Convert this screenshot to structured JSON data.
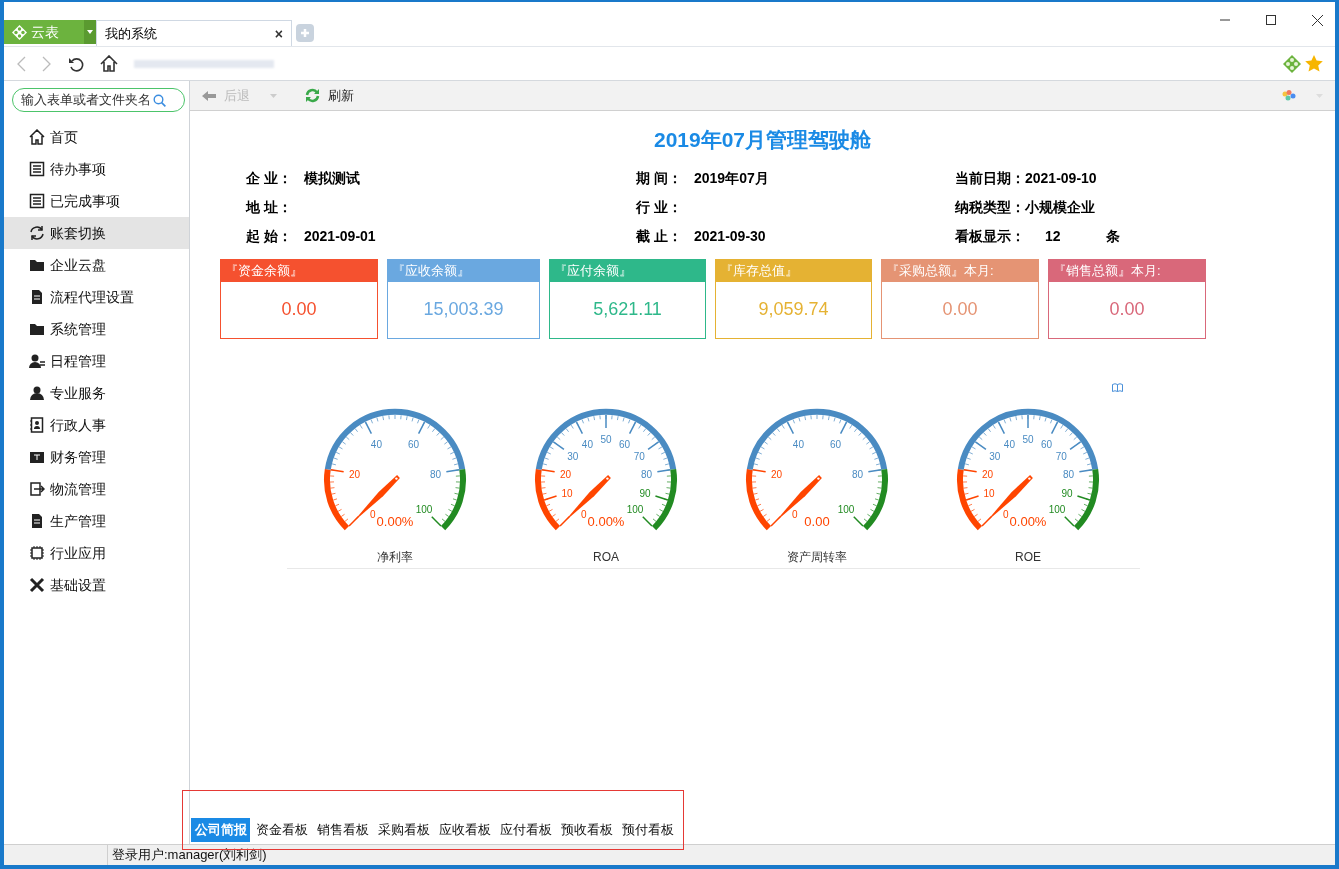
{
  "browser": {
    "brand_button": "云表",
    "tab": {
      "title": "我的系统",
      "close": "×"
    }
  },
  "sidebar": {
    "search": {
      "placeholder": "输入表单或者文件夹名"
    },
    "items": [
      {
        "label": "首页",
        "selected": false
      },
      {
        "label": "待办事项",
        "selected": false
      },
      {
        "label": "已完成事项",
        "selected": false
      },
      {
        "label": "账套切换",
        "selected": true
      },
      {
        "label": "企业云盘",
        "selected": false
      },
      {
        "label": "流程代理设置",
        "selected": false
      },
      {
        "label": "系统管理",
        "selected": false
      },
      {
        "label": "日程管理",
        "selected": false
      },
      {
        "label": "专业服务",
        "selected": false
      },
      {
        "label": "行政人事",
        "selected": false
      },
      {
        "label": "财务管理",
        "selected": false
      },
      {
        "label": "物流管理",
        "selected": false
      },
      {
        "label": "生产管理",
        "selected": false
      },
      {
        "label": "行业应用",
        "selected": false
      },
      {
        "label": "基础设置",
        "selected": false
      }
    ]
  },
  "toolbar": {
    "back": {
      "label": "后退",
      "disabled": true
    },
    "refresh": "刷新"
  },
  "title": "2019年07月管理驾驶舱",
  "info": [
    {
      "label": "企 业：",
      "value": "模拟测试"
    },
    {
      "label": "期 间：",
      "value": "2019年07月"
    },
    {
      "label": "当前日期：",
      "value": "2021-09-10"
    },
    {
      "label": "地 址："
    },
    {
      "label": "行 业："
    },
    {
      "label": "纳税类型：",
      "value": "小规模企业"
    },
    {
      "label": "起 始：",
      "value": "2021-09-01"
    },
    {
      "label": "截 止：",
      "value": "2021-09-30"
    },
    {
      "label": "看板显示：",
      "value": "12",
      "unit": "条"
    }
  ],
  "cards": [
    {
      "title": "『资金余额』",
      "value": "0.00",
      "color": "#f5512f"
    },
    {
      "title": "『应收余额』",
      "value": "15,003.39",
      "color": "#6aa8e0"
    },
    {
      "title": "『应付余额』",
      "value": "5,621.11",
      "color": "#2eb88a"
    },
    {
      "title": "『库存总值』",
      "value": "9,059.74",
      "color": "#e5b233"
    },
    {
      "title": "『采购总额』本月:",
      "value": "0.00",
      "color": "#e59474"
    },
    {
      "title": "『销售总额』本月:",
      "value": "0.00",
      "color": "#d9687a"
    }
  ],
  "gauges": [
    {
      "label": "净利率",
      "reading": "0.00%",
      "ticks": [
        "0",
        "20",
        "40",
        "60",
        "80",
        "100"
      ]
    },
    {
      "label": "ROA",
      "reading": "0.00%",
      "ticks": [
        "0",
        "10",
        "20",
        "30",
        "40",
        "50",
        "60",
        "70",
        "80",
        "90",
        "100"
      ]
    },
    {
      "label": "资产周转率",
      "reading": "0.00",
      "ticks": [
        "0",
        "20",
        "40",
        "60",
        "80",
        "100"
      ]
    },
    {
      "label": "ROE",
      "reading": "0.00%",
      "ticks": [
        "0",
        "10",
        "20",
        "30",
        "40",
        "50",
        "60",
        "70",
        "80",
        "90",
        "100"
      ]
    }
  ],
  "bottom_tabs": [
    {
      "label": "公司简报",
      "selected": true
    },
    {
      "label": "资金看板",
      "selected": false
    },
    {
      "label": "销售看板",
      "selected": false
    },
    {
      "label": "采购看板",
      "selected": false
    },
    {
      "label": "应收看板",
      "selected": false
    },
    {
      "label": "应付看板",
      "selected": false
    },
    {
      "label": "预收看板",
      "selected": false
    },
    {
      "label": "预付看板",
      "selected": false
    }
  ],
  "status_bar": "登录用户:manager(刘利剑)"
}
